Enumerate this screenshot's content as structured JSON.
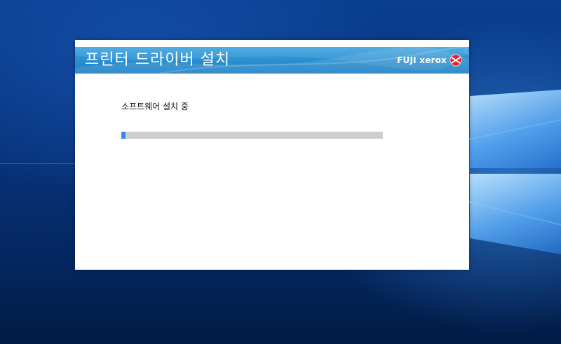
{
  "installer": {
    "title": "프린터 드라이버 설치",
    "brand": "FUJI xerox",
    "logo_icon": "xerox-logo-icon",
    "status_text": "소프트웨어 설치 중",
    "progress": 0.015
  },
  "colors": {
    "banner": "#2a8fd1",
    "progress_fill": "#3c85e6",
    "progress_track": "#cdcdcd",
    "logo_red": "#d9262f"
  }
}
